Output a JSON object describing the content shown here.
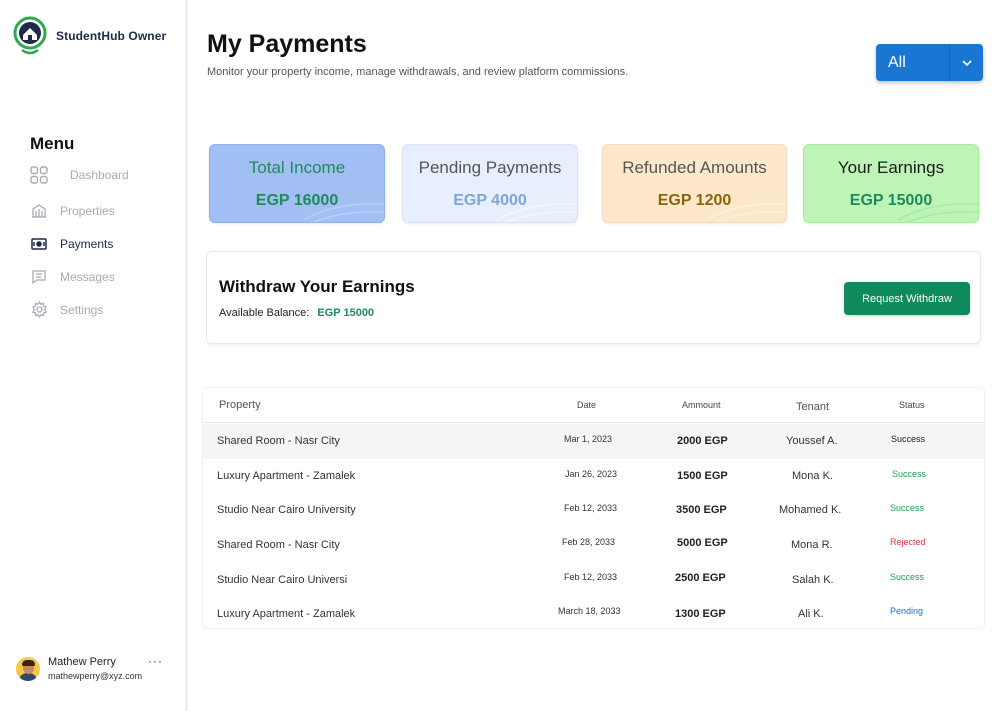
{
  "brand": {
    "name": "StudentHub Owner"
  },
  "sidebar": {
    "menu_title": "Menu",
    "items": [
      {
        "label": "Dashboard",
        "icon": "dashboard-icon",
        "active": false
      },
      {
        "label": "Properties",
        "icon": "building-icon",
        "active": false
      },
      {
        "label": "Payments",
        "icon": "payments-icon",
        "active": true
      },
      {
        "label": "Messages",
        "icon": "message-icon",
        "active": false
      },
      {
        "label": "Settings",
        "icon": "gear-icon",
        "active": false
      }
    ]
  },
  "user": {
    "name": "Mathew Perry",
    "email": "mathewperry@xyz.com",
    "more": "···"
  },
  "header": {
    "title": "My Payments",
    "subtitle": "Monitor your property income, manage withdrawals, and review platform commissions."
  },
  "filter": {
    "value": "All",
    "caret": "⌄"
  },
  "cards": {
    "income": {
      "title": "Total Income",
      "value": "EGP 16000"
    },
    "pending": {
      "title": "Pending Payments",
      "value": "EGP 4000"
    },
    "refund": {
      "title": "Refunded Amounts",
      "value": "EGP 1200"
    },
    "earn": {
      "title": "Your Earnings",
      "value": "EGP 15000"
    }
  },
  "withdraw": {
    "title": "Withdraw Your Earnings",
    "balance_label": "Available Balance:",
    "balance_value": "EGP 15000",
    "button_label": "Request Withdraw"
  },
  "table": {
    "headers": {
      "property": "Property",
      "date": "Date",
      "amount": "Ammount",
      "tenant": "Tenant",
      "status": "Status"
    },
    "rows": [
      {
        "property": "Shared Room - Nasr City",
        "date": "Mar 1, 2023",
        "amount": "2000 EGP",
        "tenant": "Youssef A.",
        "status": "Success",
        "status_color": "#222222"
      },
      {
        "property": "Luxury Apartment - Zamalek",
        "date": "Jan 26, 2023",
        "amount": "1500 EGP",
        "tenant": "Mona K.",
        "status": "Success",
        "status_color": "#1f9d55"
      },
      {
        "property": "Studio Near Cairo University",
        "date": "Feb 12, 2033",
        "amount": "3500 EGP",
        "tenant": "Mohamed K.",
        "status": "Success",
        "status_color": "#1f9d55"
      },
      {
        "property": "Shared Room - Nasr City",
        "date": "Feb 28, 2033",
        "amount": "5000 EGP",
        "tenant": "Mona R.",
        "status": "Rejected",
        "status_color": "#d63b3b"
      },
      {
        "property": "Studio Near Cairo Universi",
        "date": "Feb 12, 2033",
        "amount": "2500 EGP",
        "tenant": "Salah K.",
        "status": "Success",
        "status_color": "#1f9d55"
      },
      {
        "property": "Luxury Apartment - Zamalek",
        "date": "March 18, 2033",
        "amount": "1300 EGP",
        "tenant": "Ali K.",
        "status": "Pending",
        "status_color": "#1976d2"
      }
    ]
  },
  "colors": {
    "accent": "#1976d2",
    "success_button": "#0e8a5c",
    "brand_green": "#2fa84f",
    "brand_navy": "#1d2a4a"
  }
}
